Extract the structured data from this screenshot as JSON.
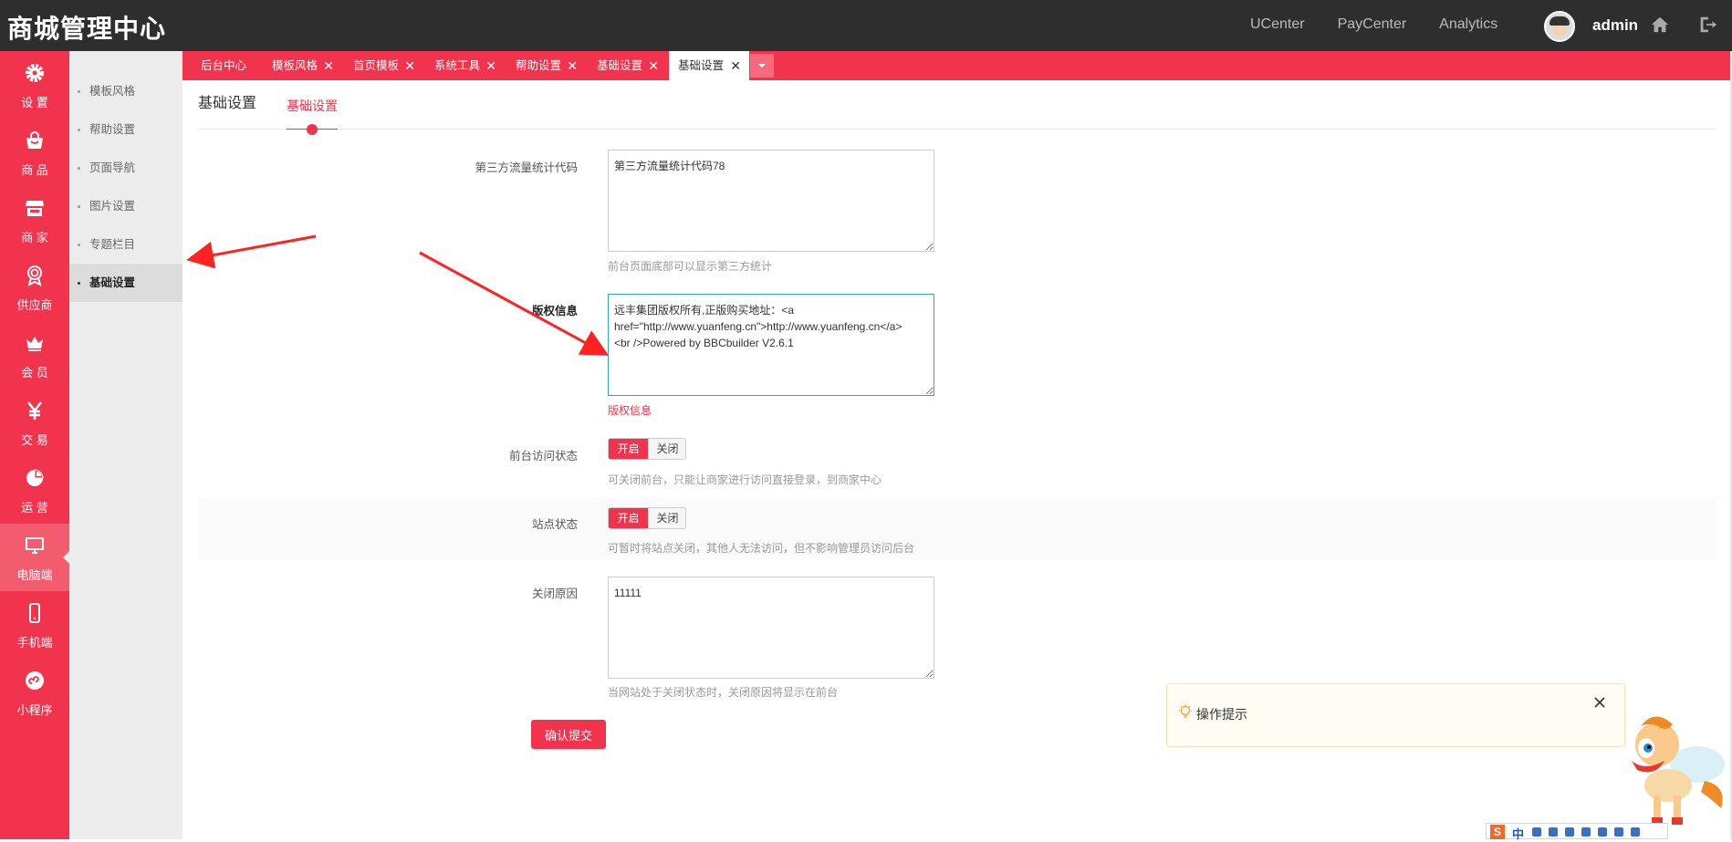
{
  "brand": "商城管理中心",
  "topnav": [
    "UCenter",
    "PayCenter",
    "Analytics"
  ],
  "user": {
    "name": "admin"
  },
  "leftnav": [
    {
      "label": "设 置",
      "icon": "gear-icon"
    },
    {
      "label": "商 品",
      "icon": "shopping-bag-icon"
    },
    {
      "label": "商 家",
      "icon": "store-icon"
    },
    {
      "label": "供应商",
      "icon": "award-icon"
    },
    {
      "label": "会 员",
      "icon": "crown-icon"
    },
    {
      "label": "交 易",
      "icon": "yen-icon"
    },
    {
      "label": "运 营",
      "icon": "pie-chart-icon"
    },
    {
      "label": "电脑端",
      "icon": "monitor-icon",
      "active": true
    },
    {
      "label": "手机端",
      "icon": "mobile-icon"
    },
    {
      "label": "小程序",
      "icon": "mini-program-icon"
    }
  ],
  "subnav": [
    "模板风格",
    "帮助设置",
    "页面导航",
    "图片设置",
    "专题栏目",
    "基础设置"
  ],
  "tabs": [
    "后台中心",
    "模板风格",
    "首页模板",
    "系统工具",
    "帮助设置",
    "基础设置",
    "基础设置"
  ],
  "page": {
    "title": "基础设置",
    "subtab": "基础设置"
  },
  "form": {
    "stats": {
      "label": "第三方流量统计代码",
      "value": "第三方流量统计代码78",
      "hint": "前台页面底部可以显示第三方统计"
    },
    "copyright": {
      "label": "版权信息",
      "value": "远丰集团版权所有,正版购买地址：<a href=\"http://www.yuanfeng.cn\">http://www.yuanfeng.cn</a>\n<br />Powered by BBCbuilder V2.6.1",
      "hint": "版权信息"
    },
    "front_access": {
      "label": "前台访问状态",
      "on": "开启",
      "off": "关闭",
      "hint": "可关闭前台，只能让商家进行访问直接登录，到商家中心"
    },
    "site_status": {
      "label": "站点状态",
      "on": "开启",
      "off": "关闭",
      "hint": "可暂时将站点关闭，其他人无法访问，但不影响管理员访问后台"
    },
    "close_reason": {
      "label": "关闭原因",
      "value": "11111",
      "hint": "当网站处于关闭状态时，关闭原因将显示在前台"
    },
    "submit": "确认提交"
  },
  "tip": {
    "text": "操作提示"
  },
  "ime": {
    "mode": "中"
  },
  "colors": {
    "accent": "#f1334d",
    "topbar": "#2e2e2e",
    "annotation_arrow": "#f22"
  }
}
